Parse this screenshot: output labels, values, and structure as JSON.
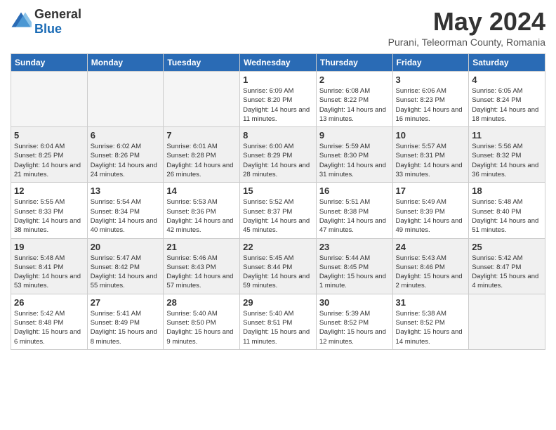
{
  "logo": {
    "general": "General",
    "blue": "Blue"
  },
  "header": {
    "month_year": "May 2024",
    "location": "Purani, Teleorman County, Romania"
  },
  "weekdays": [
    "Sunday",
    "Monday",
    "Tuesday",
    "Wednesday",
    "Thursday",
    "Friday",
    "Saturday"
  ],
  "weeks": [
    [
      {
        "day": "",
        "empty": true
      },
      {
        "day": "",
        "empty": true
      },
      {
        "day": "",
        "empty": true
      },
      {
        "day": "1",
        "info": "Sunrise: 6:09 AM\nSunset: 8:20 PM\nDaylight: 14 hours\nand 11 minutes."
      },
      {
        "day": "2",
        "info": "Sunrise: 6:08 AM\nSunset: 8:22 PM\nDaylight: 14 hours\nand 13 minutes."
      },
      {
        "day": "3",
        "info": "Sunrise: 6:06 AM\nSunset: 8:23 PM\nDaylight: 14 hours\nand 16 minutes."
      },
      {
        "day": "4",
        "info": "Sunrise: 6:05 AM\nSunset: 8:24 PM\nDaylight: 14 hours\nand 18 minutes."
      }
    ],
    [
      {
        "day": "5",
        "info": "Sunrise: 6:04 AM\nSunset: 8:25 PM\nDaylight: 14 hours\nand 21 minutes.",
        "shaded": true
      },
      {
        "day": "6",
        "info": "Sunrise: 6:02 AM\nSunset: 8:26 PM\nDaylight: 14 hours\nand 24 minutes.",
        "shaded": true
      },
      {
        "day": "7",
        "info": "Sunrise: 6:01 AM\nSunset: 8:28 PM\nDaylight: 14 hours\nand 26 minutes.",
        "shaded": true
      },
      {
        "day": "8",
        "info": "Sunrise: 6:00 AM\nSunset: 8:29 PM\nDaylight: 14 hours\nand 28 minutes.",
        "shaded": true
      },
      {
        "day": "9",
        "info": "Sunrise: 5:59 AM\nSunset: 8:30 PM\nDaylight: 14 hours\nand 31 minutes.",
        "shaded": true
      },
      {
        "day": "10",
        "info": "Sunrise: 5:57 AM\nSunset: 8:31 PM\nDaylight: 14 hours\nand 33 minutes.",
        "shaded": true
      },
      {
        "day": "11",
        "info": "Sunrise: 5:56 AM\nSunset: 8:32 PM\nDaylight: 14 hours\nand 36 minutes.",
        "shaded": true
      }
    ],
    [
      {
        "day": "12",
        "info": "Sunrise: 5:55 AM\nSunset: 8:33 PM\nDaylight: 14 hours\nand 38 minutes."
      },
      {
        "day": "13",
        "info": "Sunrise: 5:54 AM\nSunset: 8:34 PM\nDaylight: 14 hours\nand 40 minutes."
      },
      {
        "day": "14",
        "info": "Sunrise: 5:53 AM\nSunset: 8:36 PM\nDaylight: 14 hours\nand 42 minutes."
      },
      {
        "day": "15",
        "info": "Sunrise: 5:52 AM\nSunset: 8:37 PM\nDaylight: 14 hours\nand 45 minutes."
      },
      {
        "day": "16",
        "info": "Sunrise: 5:51 AM\nSunset: 8:38 PM\nDaylight: 14 hours\nand 47 minutes."
      },
      {
        "day": "17",
        "info": "Sunrise: 5:49 AM\nSunset: 8:39 PM\nDaylight: 14 hours\nand 49 minutes."
      },
      {
        "day": "18",
        "info": "Sunrise: 5:48 AM\nSunset: 8:40 PM\nDaylight: 14 hours\nand 51 minutes."
      }
    ],
    [
      {
        "day": "19",
        "info": "Sunrise: 5:48 AM\nSunset: 8:41 PM\nDaylight: 14 hours\nand 53 minutes.",
        "shaded": true
      },
      {
        "day": "20",
        "info": "Sunrise: 5:47 AM\nSunset: 8:42 PM\nDaylight: 14 hours\nand 55 minutes.",
        "shaded": true
      },
      {
        "day": "21",
        "info": "Sunrise: 5:46 AM\nSunset: 8:43 PM\nDaylight: 14 hours\nand 57 minutes.",
        "shaded": true
      },
      {
        "day": "22",
        "info": "Sunrise: 5:45 AM\nSunset: 8:44 PM\nDaylight: 14 hours\nand 59 minutes.",
        "shaded": true
      },
      {
        "day": "23",
        "info": "Sunrise: 5:44 AM\nSunset: 8:45 PM\nDaylight: 15 hours\nand 1 minute.",
        "shaded": true
      },
      {
        "day": "24",
        "info": "Sunrise: 5:43 AM\nSunset: 8:46 PM\nDaylight: 15 hours\nand 2 minutes.",
        "shaded": true
      },
      {
        "day": "25",
        "info": "Sunrise: 5:42 AM\nSunset: 8:47 PM\nDaylight: 15 hours\nand 4 minutes.",
        "shaded": true
      }
    ],
    [
      {
        "day": "26",
        "info": "Sunrise: 5:42 AM\nSunset: 8:48 PM\nDaylight: 15 hours\nand 6 minutes."
      },
      {
        "day": "27",
        "info": "Sunrise: 5:41 AM\nSunset: 8:49 PM\nDaylight: 15 hours\nand 8 minutes."
      },
      {
        "day": "28",
        "info": "Sunrise: 5:40 AM\nSunset: 8:50 PM\nDaylight: 15 hours\nand 9 minutes."
      },
      {
        "day": "29",
        "info": "Sunrise: 5:40 AM\nSunset: 8:51 PM\nDaylight: 15 hours\nand 11 minutes."
      },
      {
        "day": "30",
        "info": "Sunrise: 5:39 AM\nSunset: 8:52 PM\nDaylight: 15 hours\nand 12 minutes."
      },
      {
        "day": "31",
        "info": "Sunrise: 5:38 AM\nSunset: 8:52 PM\nDaylight: 15 hours\nand 14 minutes."
      },
      {
        "day": "",
        "empty": true
      }
    ]
  ]
}
